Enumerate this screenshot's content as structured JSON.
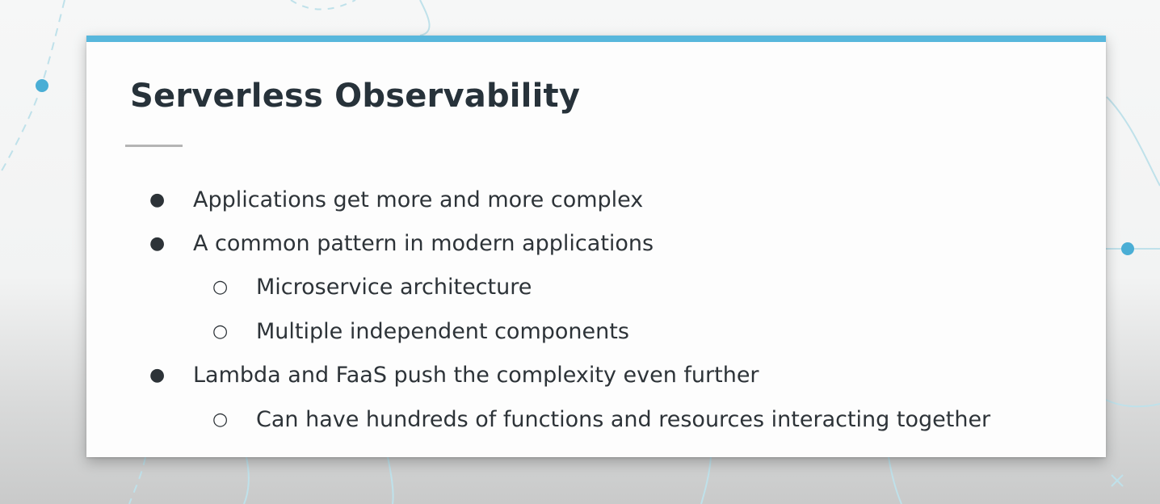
{
  "slide": {
    "title": "Serverless Observability",
    "accent_color": "#58b7dc",
    "bullets": [
      {
        "level": 1,
        "marker": "●",
        "text": "Applications get more and more complex"
      },
      {
        "level": 1,
        "marker": "●",
        "text": "A common pattern in modern applications"
      },
      {
        "level": 2,
        "marker": "○",
        "text": "Microservice architecture"
      },
      {
        "level": 2,
        "marker": "○",
        "text": "Multiple independent components"
      },
      {
        "level": 1,
        "marker": "●",
        "text": "Lambda and FaaS push the complexity even further"
      },
      {
        "level": 2,
        "marker": "○",
        "text": "Can have hundreds of functions and resources interacting together"
      }
    ]
  }
}
